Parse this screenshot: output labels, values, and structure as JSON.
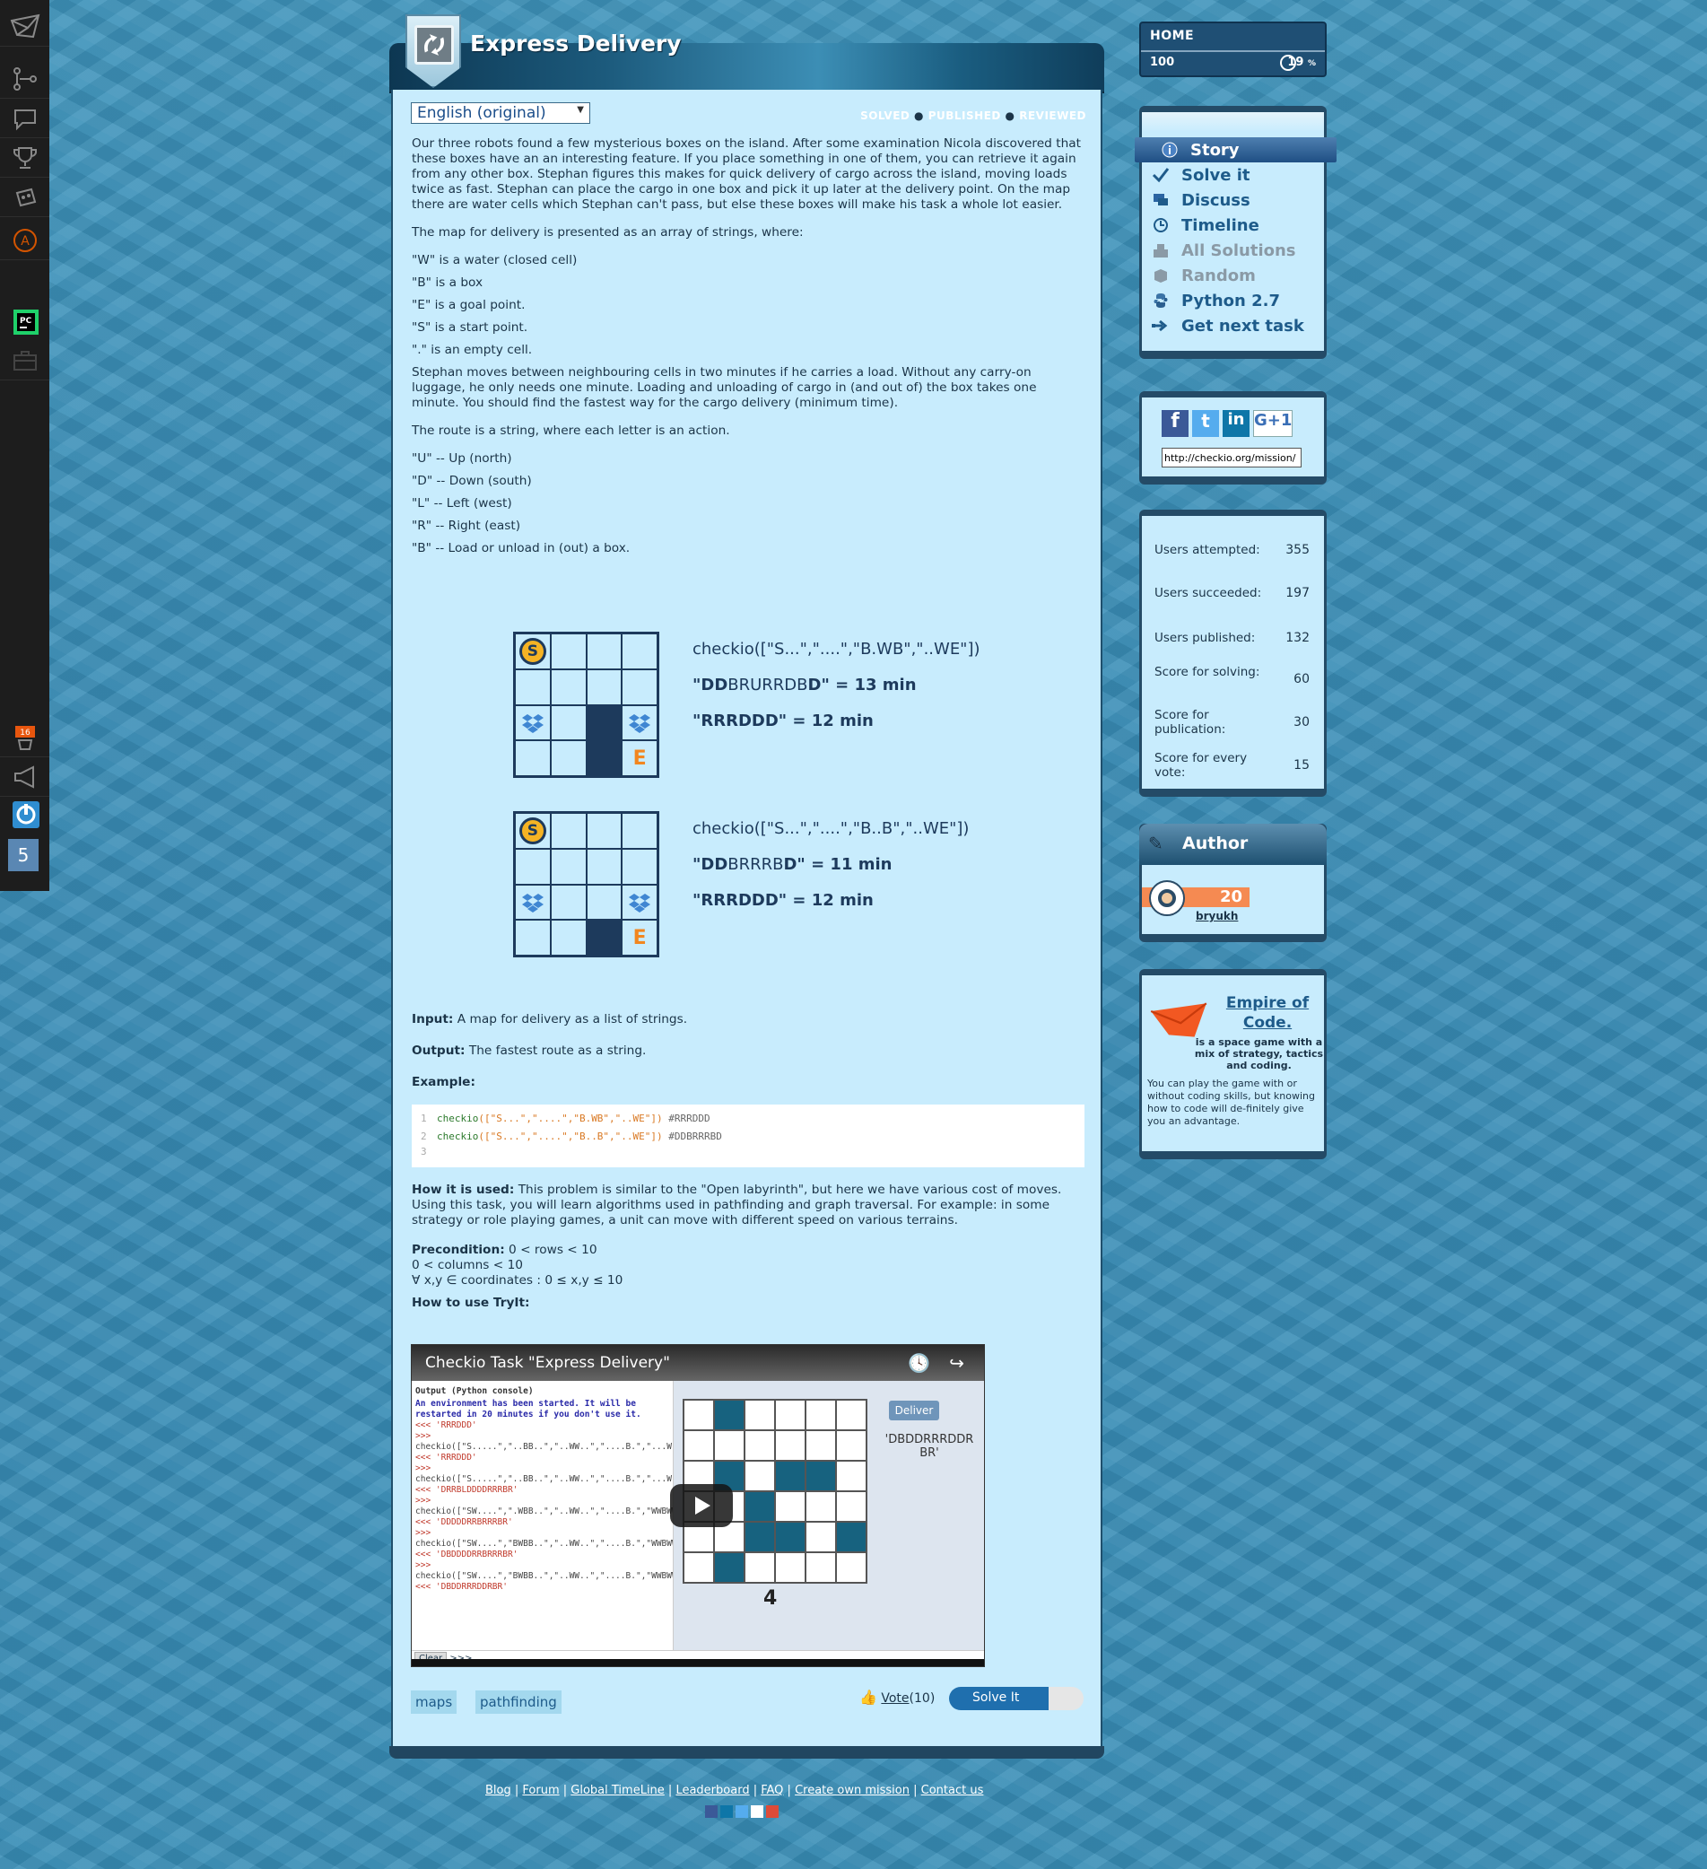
{
  "leftbar": {
    "icons": [
      "checkio-logo-icon",
      "tree-icon",
      "chat-icon",
      "trophy-icon",
      "robot-icon",
      "a-circle-icon",
      "pycharm-icon",
      "briefcase-icon",
      "notification-icon",
      "megaphone-icon",
      "power-icon"
    ],
    "counter": "5",
    "badge": "16"
  },
  "task": {
    "title": "Express Delivery",
    "language": "English (original)",
    "status": {
      "solved": "SOLVED",
      "published": "PUBLISHED",
      "reviewed": "REVIEWED"
    },
    "intro": "Our three robots found a few mysterious boxes on the island. After some examination Nicola discovered that these boxes have an an interesting feature. If you place something in one of them, you can retrieve it again from any other box. Stephan figures this makes for quick delivery of cargo across the island, moving loads twice as fast. Stephan can place the cargo in one box and pick it up later at the delivery point. On the map there are water cells which Stephan can't pass, but else these boxes will make his task a whole lot easier.",
    "map_intro": "The map for delivery is presented as an array of strings, where:",
    "map_items": [
      "\"W\" is a water (closed cell)",
      "\"B\" is a box",
      "\"E\" is a goal point.",
      "\"S\" is a start point.",
      "\".\" is an empty cell."
    ],
    "moves": "Stephan moves between neighbouring cells in two minutes if he carries a load. Without any carry-on luggage, he only needs one minute. Loading and unloading of cargo in (and out of) the box takes one minute. You should find the fastest way for the cargo delivery (minimum time).",
    "route_intro": "The route is a string, where each letter is an action.",
    "route_items": [
      "\"U\" -- Up (north)",
      "\"D\" -- Down (south)",
      "\"L\" -- Left (west)",
      "\"R\" -- Right (east)",
      "\"B\" -- Load or unload in (out) a box."
    ],
    "figures": [
      {
        "call": "checkio([\"S...\",\"....\",\"B.WB\",\"..WE\"])",
        "l1a": "\"DD",
        "l1b": "BRURRDB",
        "l1c": "D\" = 13 min",
        "l2": "\"RRRDDD\" = 12 min",
        "cells": [
          "S",
          "",
          "",
          "",
          "",
          "",
          "",
          "",
          "B",
          "",
          "W",
          "B",
          "",
          "",
          "W",
          "E"
        ]
      },
      {
        "call": "checkio([\"S...\",\"....\",\"B..B\",\"..WE\"])",
        "l1a": "\"DD",
        "l1b": "BRRRB",
        "l1c": "D\" = 11 min",
        "l2": "\"RRRDDD\" = 12 min",
        "cells": [
          "S",
          "",
          "",
          "",
          "",
          "",
          "",
          "",
          "B",
          "",
          "",
          "B",
          "",
          "",
          "W",
          "E"
        ]
      }
    ],
    "input_label": "Input:",
    "input_text": "A map for delivery as a list of strings.",
    "output_label": "Output:",
    "output_text": "The fastest route as a string.",
    "example_label": "Example:",
    "code": [
      {
        "n": "1",
        "fn": "checkio",
        "args": "([\"S...\",\"....\",\"B.WB\",\"..WE\"])",
        "comment": "#RRRDDD"
      },
      {
        "n": "2",
        "fn": "checkio",
        "args": "([\"S...\",\"....\",\"B..B\",\"..WE\"])",
        "comment": "#DDBRRRBD"
      },
      {
        "n": "3",
        "fn": "",
        "args": "",
        "comment": ""
      }
    ],
    "how_label": "How it is used:",
    "how_text": "This problem is similar to the \"Open labyrinth\", but here we have various cost of moves. Using this task, you will learn algorithms used in pathfinding and graph traversal. For example: in some strategy or role playing games, a unit can move with different speed on various terrains.",
    "precondition_label": "Precondition:",
    "precondition_lines": [
      "0 < rows < 10",
      "0 < columns < 10",
      "∀ x,y ∈ coordinates : 0 ≤ x,y ≤ 10"
    ],
    "tryit_label": "How to use TryIt:",
    "video": {
      "title": "Checkio Task \"Express Delivery\"",
      "console_header": "Output (Python console)",
      "console_lines": [
        "An environment has been started. It will be",
        "restarted in 20 minutes if you don't use it.",
        "<<< 'RRRDDD'",
        ">>>",
        "checkio([\"S.....\",\"..BB..\",\"..WW..\",\"....B.\",\"...W.\",\"..B.BE\"])",
        "<<< 'RRRDDD'",
        ">>>",
        "checkio([\"S.....\",\"..BB..\",\"..WW..\",\"....B.\",\"...W.\",\"..B.BE\"])",
        "<<< 'DRRBLDDDDRRRBR'",
        ">>>",
        "checkio([\"SW....\",\".WBB..\",\"..WW..\",\"....B.\",\"WWBWW\",\"..B.BE\"])",
        "<<< 'DDDDDRRBRRRBR'",
        ">>>",
        "checkio([\"SW....\",\"BWBB..\",\"..WW..\",\"....B.\",\"WWBWW\",\"..B.BE\"])",
        "<<< 'DBDDDDRRBRRRBR'",
        ">>>",
        "checkio([\"SW....\",\"BWBB..\",\"..WW..\",\"....B.\",\"WWBWW\",\".WB.BE\"])",
        "<<< 'DBDDRRRDDRBR'"
      ],
      "deliver": "Deliver",
      "result": "'DBDDRRRDDR BR'",
      "step": "4",
      "clear": "Clear",
      "prompt": ">>>"
    },
    "tags": [
      "maps",
      "pathfinding"
    ],
    "vote_label": "Vote",
    "vote_count": "(10)",
    "solve_label": "Solve It"
  },
  "sidebar": {
    "home": "HOME",
    "level": "100",
    "percent": "19",
    "percent_sign": "%",
    "menu": [
      {
        "label": "Story",
        "icon": "info-icon",
        "state": "active"
      },
      {
        "label": "Solve it",
        "icon": "check-icon",
        "state": "normal"
      },
      {
        "label": "Discuss",
        "icon": "discuss-icon",
        "state": "normal"
      },
      {
        "label": "Timeline",
        "icon": "clock-icon",
        "state": "normal"
      },
      {
        "label": "All Solutions",
        "icon": "solutions-icon",
        "state": "disabled"
      },
      {
        "label": "Random",
        "icon": "box-icon",
        "state": "disabled"
      },
      {
        "label": "Python 2.7",
        "icon": "python-icon",
        "state": "normal"
      },
      {
        "label": "Get next task",
        "icon": "next-arrow-icon",
        "state": "normal"
      }
    ],
    "share_url": "http://checkio.org/mission/",
    "stats": [
      {
        "label": "Users attempted:",
        "value": "355"
      },
      {
        "label": "Users succeeded:",
        "value": "197"
      },
      {
        "label": "Users published:",
        "value": "132"
      },
      {
        "label": "Score for solving:",
        "value": "60"
      },
      {
        "label": "Score for publication:",
        "value": "30"
      },
      {
        "label": "Score for every vote:",
        "value": "15"
      }
    ],
    "author_title": "Author",
    "author_level": "20",
    "author_name": "bryukh",
    "promo_title": "Empire of Code.",
    "promo_sub": "is a space game with a mix of strategy, tactics and coding.",
    "promo_text": "You can play the game with or without coding skills, but knowing how to code will de-finitely give you an advantage."
  },
  "footer": {
    "links": [
      "Blog",
      "Forum",
      "Global TimeLine",
      "Leaderboard",
      "FAQ",
      "Create own mission",
      "Contact us"
    ]
  },
  "colors": {
    "accent": "#1e5b8a",
    "panel": "#c8ecfd",
    "water": "#1d3a5c",
    "goal": "#f2861f",
    "coin": "#f5b324"
  }
}
